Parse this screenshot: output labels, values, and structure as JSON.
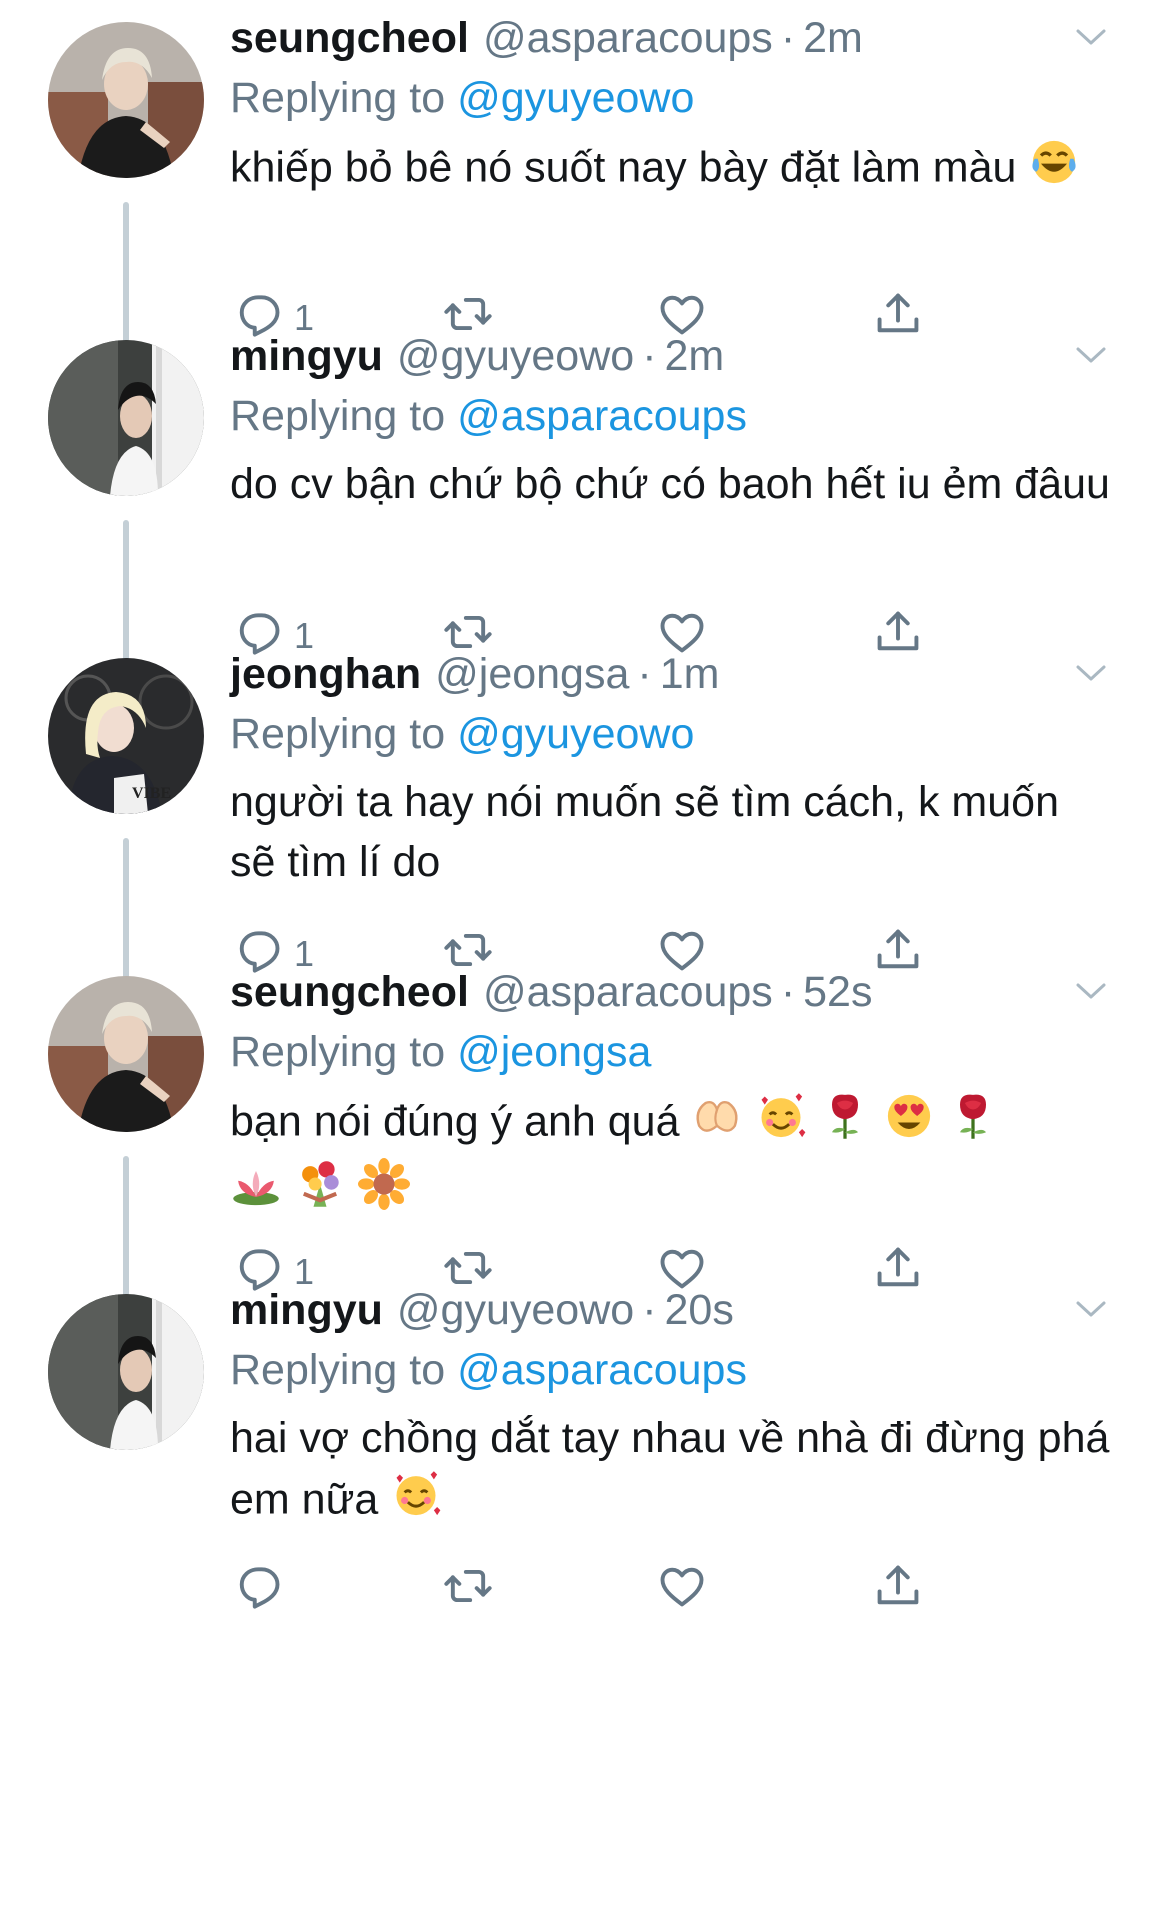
{
  "tweets": [
    {
      "name": "seungcheol",
      "handle": "@asparacoups",
      "time": "2m",
      "replying_label": "Replying to",
      "replying_to": "@gyuyeowo",
      "text": "khiếp bỏ bê nó suốt nay bày đặt làm màu",
      "emojis": [
        "face-with-tears-of-joy"
      ],
      "reply_count": "1",
      "avatar": "seungcheol-photo"
    },
    {
      "name": "mingyu",
      "handle": "@gyuyeowo",
      "time": "2m",
      "replying_label": "Replying to",
      "replying_to": "@asparacoups",
      "text": "do cv bận chứ bộ chứ có baoh hết iu ẻm đâuu",
      "emojis": [],
      "reply_count": "1",
      "avatar": "mingyu-photo"
    },
    {
      "name": "jeonghan",
      "handle": "@jeongsa",
      "time": "1m",
      "replying_label": "Replying to",
      "replying_to": "@gyuyeowo",
      "text": "người ta hay nói muốn sẽ tìm cách, k muốn sẽ tìm lí do",
      "emojis": [],
      "reply_count": "1",
      "avatar": "jeonghan-photo"
    },
    {
      "name": "seungcheol",
      "handle": "@asparacoups",
      "time": "52s",
      "replying_label": "Replying to",
      "replying_to": "@jeongsa",
      "text": "bạn nói đúng ý anh quá",
      "emojis": [
        "heart-hands",
        "smiling-face-with-hearts",
        "rose",
        "heart-eyes",
        "rose",
        "lotus",
        "bouquet",
        "sunflower"
      ],
      "reply_count": "1",
      "avatar": "seungcheol-photo"
    },
    {
      "name": "mingyu",
      "handle": "@gyuyeowo",
      "time": "20s",
      "replying_label": "Replying to",
      "replying_to": "@asparacoups",
      "text": "hai vợ chồng dắt tay nhau về nhà đi đừng phá em nữa",
      "emojis": [
        "smiling-face-with-hearts"
      ],
      "reply_count": "",
      "avatar": "mingyu-photo"
    }
  ],
  "icons": {
    "reply": "reply-icon",
    "retweet": "retweet-icon",
    "like": "heart-icon",
    "share": "share-icon",
    "menu": "chevron-down-icon"
  },
  "colors": {
    "text": "#14171a",
    "muted": "#657786",
    "link": "#1b95e0",
    "thread_line": "#c4cfd6"
  }
}
